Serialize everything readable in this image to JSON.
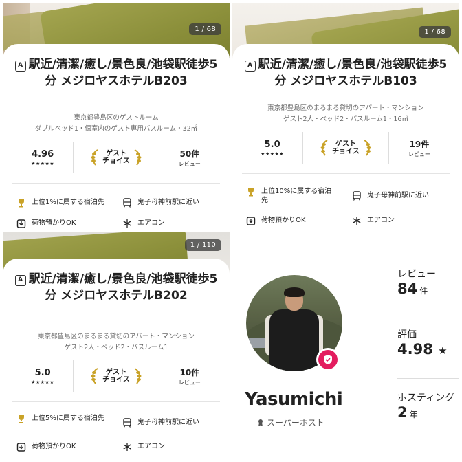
{
  "listings": [
    {
      "counter": "1 / 68",
      "title": "駅近/清潔/癒し/景色良/池袋駅徒歩5分 メジロヤスホテルB203",
      "subtitle1": "東京都豊島区のゲストルーム",
      "subtitle2": "ダブルベッド1・個室内のゲスト専用バスルーム・32㎡",
      "rating": "4.96",
      "stars": "★★★★★",
      "guest_choice": [
        "ゲスト",
        "チョイス"
      ],
      "review_count": "50件",
      "review_label": "レビュー",
      "amenities": [
        {
          "icon": "trophy-icon",
          "label": "上位1%に属する宿泊先"
        },
        {
          "icon": "train-icon",
          "label": "鬼子母神前駅に近い"
        },
        {
          "icon": "luggage-icon",
          "label": "荷物預かりOK"
        },
        {
          "icon": "snowflake-icon",
          "label": "エアコン"
        }
      ]
    },
    {
      "counter": "1 / 68",
      "title": "駅近/清潔/癒し/景色良/池袋駅徒歩5分 メジロヤスホテルB103",
      "subtitle1": "東京都豊島区のまるまる貸切のアパート・マンション",
      "subtitle2": "ゲスト2人・ベッド2・バスルーム1・16㎡",
      "rating": "5.0",
      "stars": "★★★★★",
      "guest_choice": [
        "ゲスト",
        "チョイス"
      ],
      "review_count": "19件",
      "review_label": "レビュー",
      "amenities": [
        {
          "icon": "trophy-icon",
          "label": "上位10%に属する宿泊先"
        },
        {
          "icon": "train-icon",
          "label": "鬼子母神前駅に近い"
        },
        {
          "icon": "luggage-icon",
          "label": "荷物預かりOK"
        },
        {
          "icon": "snowflake-icon",
          "label": "エアコン"
        }
      ]
    },
    {
      "counter": "1 / 110",
      "title": "駅近/清潔/癒し/景色良/池袋駅徒歩5分 メジロヤスホテルB202",
      "subtitle1": "東京都豊島区のまるまる貸切のアパート・マンション",
      "subtitle2": "ゲスト2人・ベッド2・バスルーム1",
      "rating": "5.0",
      "stars": "★★★★★",
      "guest_choice": [
        "ゲスト",
        "チョイス"
      ],
      "review_count": "10件",
      "review_label": "レビュー",
      "amenities": [
        {
          "icon": "trophy-icon",
          "label": "上位5%に属する宿泊先"
        },
        {
          "icon": "train-icon",
          "label": "鬼子母神前駅に近い"
        },
        {
          "icon": "luggage-icon",
          "label": "荷物預かりOK"
        },
        {
          "icon": "snowflake-icon",
          "label": "エアコン"
        }
      ]
    }
  ],
  "host": {
    "name": "Yasumichi",
    "role": "スーパーホスト",
    "reviews_label": "レビュー",
    "reviews_value": "84",
    "reviews_unit": "件",
    "rating_label": "評価",
    "rating_value": "4.98",
    "rating_star": "★",
    "hosting_label": "ホスティング",
    "hosting_value": "2",
    "hosting_unit": "年"
  },
  "colors": {
    "accent": "#e31c5f",
    "laurel": "#c9a227",
    "text": "#222222",
    "muted": "#6a6a6a"
  }
}
